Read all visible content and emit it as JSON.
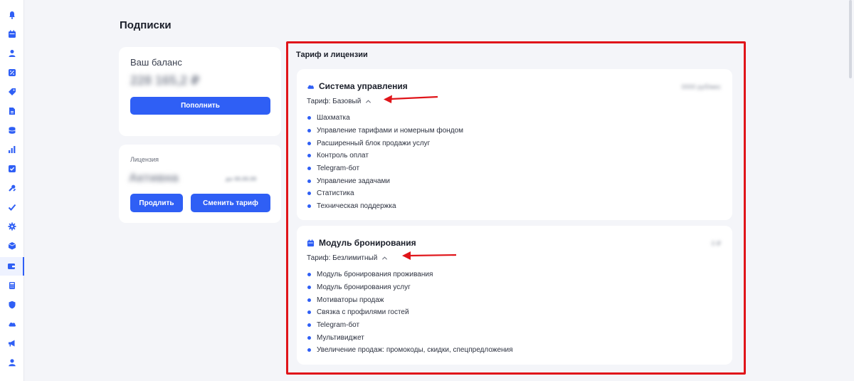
{
  "page": {
    "title": "Подписки"
  },
  "sidebar": {
    "items": [
      {
        "icon": "bell-icon"
      },
      {
        "icon": "calendar-icon"
      },
      {
        "icon": "user-icon"
      },
      {
        "icon": "percent-icon"
      },
      {
        "icon": "tag-icon"
      },
      {
        "icon": "document-icon"
      },
      {
        "icon": "coins-icon"
      },
      {
        "icon": "bar-chart-icon"
      },
      {
        "icon": "checkbox-icon"
      },
      {
        "icon": "tools-icon"
      },
      {
        "icon": "checkmark-icon"
      },
      {
        "icon": "gear-icon"
      },
      {
        "icon": "box-icon"
      },
      {
        "icon": "wallet-icon",
        "active": true
      },
      {
        "icon": "calculator-icon"
      },
      {
        "icon": "shield-icon"
      },
      {
        "icon": "cloud-icon"
      },
      {
        "icon": "megaphone-icon"
      },
      {
        "icon": "profile-icon"
      }
    ]
  },
  "balance": {
    "label": "Ваш баланс",
    "value": "228 165,2 ₽",
    "topup_label": "Пополнить"
  },
  "license": {
    "label": "Лицензия",
    "status": "Активна",
    "extra": "до 00.00.00",
    "extend_label": "Продлить",
    "change_label": "Сменить тариф"
  },
  "tariffs": {
    "title": "Тариф и лицензии",
    "modules": [
      {
        "title": "Система управления",
        "icon": "cloud-icon",
        "price": "0000 руб/мес",
        "tariff": "Тариф: Базовый",
        "features": [
          "Шахматка",
          "Управление тарифами и номерным фондом",
          "Расширенный блок продажи услуг",
          "Контроль оплат",
          "Telegram-бот",
          "Управление задачами",
          "Статистика",
          "Техническая поддержка"
        ]
      },
      {
        "title": "Модуль бронирования",
        "icon": "calendar-icon",
        "price": "0 ₽",
        "tariff": "Тариф: Безлимитный",
        "features": [
          "Модуль бронирования проживания",
          "Модуль бронирования услуг",
          "Мотиваторы продаж",
          "Связка с профилями гостей",
          "Telegram-бот",
          "Мультивиджет",
          "Увеличение продаж: промокоды, скидки, спецпредложения"
        ]
      }
    ]
  },
  "colors": {
    "accent": "#2f5ff5",
    "annotation": "#e0151a",
    "background": "#f4f5f9"
  }
}
